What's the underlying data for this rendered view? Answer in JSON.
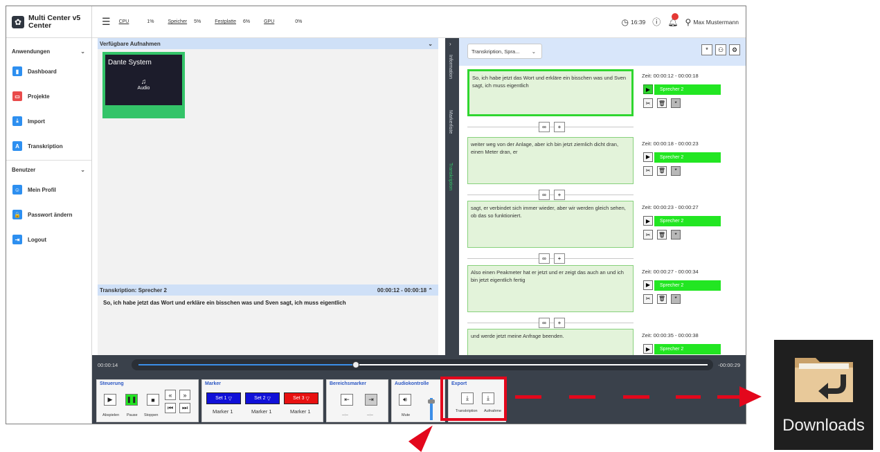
{
  "brand": {
    "title_line1": "Multi Center v5",
    "title_line2": "Center"
  },
  "sidebar": {
    "section1": "Anwendungen",
    "items1": [
      {
        "label": "Dashboard"
      },
      {
        "label": "Projekte"
      },
      {
        "label": "Import"
      },
      {
        "label": "Transkription"
      }
    ],
    "section2": "Benutzer",
    "items2": [
      {
        "label": "Mein Profil"
      },
      {
        "label": "Passwort ändern"
      },
      {
        "label": "Logout"
      }
    ]
  },
  "topbar": {
    "stats": [
      {
        "name": "CPU",
        "value": "1%"
      },
      {
        "name": "Speicher",
        "value": "5%"
      },
      {
        "name": "Festplatte",
        "value": "6%"
      },
      {
        "name": "GPU",
        "value": "0%"
      }
    ],
    "time": "16:39",
    "user": "Max Mustermann"
  },
  "left": {
    "header": "Verfügbare Aufnahmen",
    "tile_title": "Dante System",
    "tile_sub": "Audio",
    "trans_header": "Transkription: Sprecher 2",
    "trans_time": "00:00:12 - 00:00:18",
    "trans_text": "So, ich habe jetzt das Wort und erkläre ein bisschen was und Sven sagt, ich muss eigentlich"
  },
  "vtabs": {
    "t1": "Information",
    "t2": "Markerliste",
    "t3": "Transkription"
  },
  "right": {
    "select": "Transkription, Spra...",
    "segments": [
      {
        "text": "So, ich habe jetzt das Wort und erkläre ein bisschen was und Sven sagt, ich muss eigentlich",
        "time": "Zeit: 00:00:12 - 00:00:18",
        "speaker": "Sprecher 2"
      },
      {
        "text": "weiter weg von der Anlage, aber ich bin jetzt ziemlich dicht dran, einen Meter dran, er",
        "time": "Zeit: 00:00:18 - 00:00:23",
        "speaker": "Sprecher 2"
      },
      {
        "text": "sagt, er verbindet sich immer wieder, aber wir werden gleich sehen, ob das so funktioniert.",
        "time": "Zeit: 00:00:23 - 00:00:27",
        "speaker": "Sprecher 2"
      },
      {
        "text": "Also einen Peakmeter hat er jetzt und er zeigt das auch an und ich bin jetzt eigentlich fertig",
        "time": "Zeit: 00:00:27 - 00:00:34",
        "speaker": "Sprecher 2"
      },
      {
        "text": "und werde jetzt meine Anfrage beenden.",
        "time": "Zeit: 00:00:35 - 00:00:38",
        "speaker": "Sprecher 2"
      }
    ]
  },
  "timeline": {
    "current": "00:00:14",
    "remaining": "-00:00:29",
    "progress": 0.39
  },
  "controls": {
    "steuerung": "Steuerung",
    "abspielen": "Abspielen",
    "pause": "Pause",
    "stoppen": "Stoppen",
    "marker": "Marker",
    "set1": "Set 1",
    "set2": "Set 2",
    "set3": "Set 3",
    "marker_label": "Marker 1",
    "bereich": "Bereichsmarker",
    "bereich_val": "--:--",
    "audio": "Audiokontrolle",
    "mute": "Mute",
    "export": "Export",
    "export_trans": "Transkription",
    "export_aufn": "Aufnahme"
  },
  "downloads": {
    "label": "Downloads"
  },
  "colors": {
    "accent": "#2d8ff0",
    "green": "#2fd62f",
    "highlight": "#e3071c"
  }
}
